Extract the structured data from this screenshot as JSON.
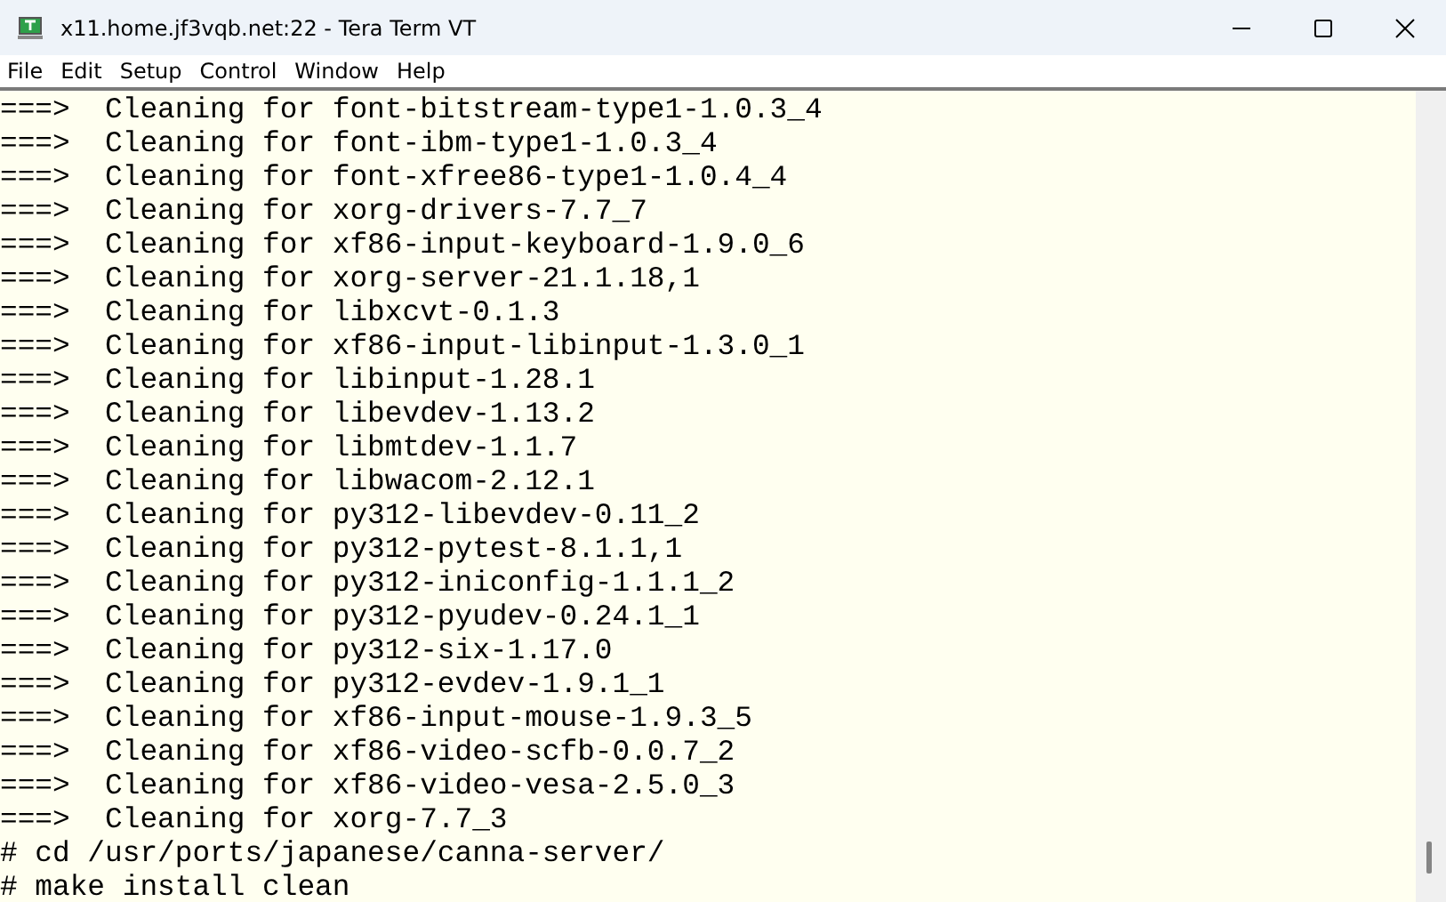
{
  "window": {
    "title": "x11.home.jf3vqb.net:22 - Tera Term VT"
  },
  "menu": [
    "File",
    "Edit",
    "Setup",
    "Control",
    "Window",
    "Help"
  ],
  "terminal_lines": [
    "===>  Cleaning for font-bitstream-type1-1.0.3_4",
    "===>  Cleaning for font-ibm-type1-1.0.3_4",
    "===>  Cleaning for font-xfree86-type1-1.0.4_4",
    "===>  Cleaning for xorg-drivers-7.7_7",
    "===>  Cleaning for xf86-input-keyboard-1.9.0_6",
    "===>  Cleaning for xorg-server-21.1.18,1",
    "===>  Cleaning for libxcvt-0.1.3",
    "===>  Cleaning for xf86-input-libinput-1.3.0_1",
    "===>  Cleaning for libinput-1.28.1",
    "===>  Cleaning for libevdev-1.13.2",
    "===>  Cleaning for libmtdev-1.1.7",
    "===>  Cleaning for libwacom-2.12.1",
    "===>  Cleaning for py312-libevdev-0.11_2",
    "===>  Cleaning for py312-pytest-8.1.1,1",
    "===>  Cleaning for py312-iniconfig-1.1.1_2",
    "===>  Cleaning for py312-pyudev-0.24.1_1",
    "===>  Cleaning for py312-six-1.17.0",
    "===>  Cleaning for py312-evdev-1.9.1_1",
    "===>  Cleaning for xf86-input-mouse-1.9.3_5",
    "===>  Cleaning for xf86-video-scfb-0.0.7_2",
    "===>  Cleaning for xf86-video-vesa-2.5.0_3",
    "===>  Cleaning for xorg-7.7_3",
    "# cd /usr/ports/japanese/canna-server/",
    "# make install clean"
  ]
}
